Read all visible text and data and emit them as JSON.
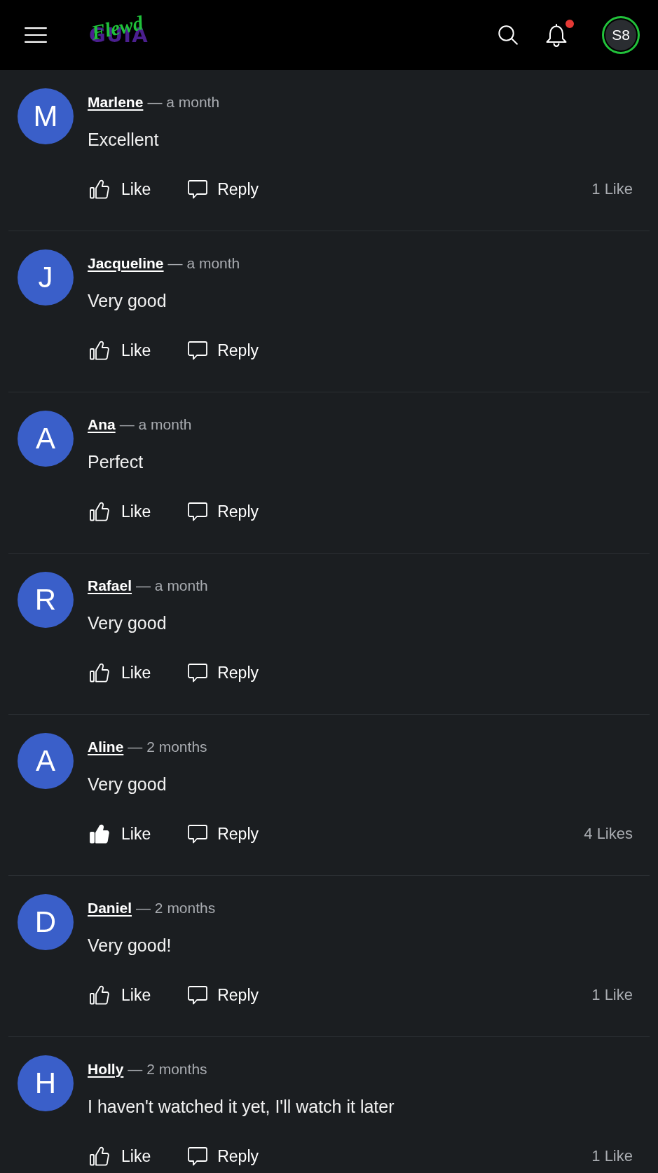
{
  "header": {
    "logo": {
      "word": "GUIA",
      "script": "Flewd"
    },
    "notifications": {
      "unread": true
    },
    "user": {
      "initials": "S8"
    }
  },
  "comments": [
    {
      "initial": "M",
      "author": "Marlene",
      "time": "— a month",
      "text": "Excellent",
      "liked": false,
      "like_label": "Like",
      "reply_label": "Reply",
      "like_count": "1 Like"
    },
    {
      "initial": "J",
      "author": "Jacqueline",
      "time": "— a month",
      "text": "Very good",
      "liked": false,
      "like_label": "Like",
      "reply_label": "Reply"
    },
    {
      "initial": "A",
      "author": "Ana",
      "time": "— a month",
      "text": "Perfect",
      "liked": false,
      "like_label": "Like",
      "reply_label": "Reply"
    },
    {
      "initial": "R",
      "author": "Rafael",
      "time": "— a month",
      "text": "Very good",
      "liked": false,
      "like_label": "Like",
      "reply_label": "Reply"
    },
    {
      "initial": "A",
      "author": "Aline",
      "time": "— 2 months",
      "text": "Very good",
      "liked": true,
      "like_label": "Like",
      "reply_label": "Reply",
      "like_count": "4 Likes"
    },
    {
      "initial": "D",
      "author": "Daniel",
      "time": "— 2 months",
      "text": "Very good!",
      "liked": false,
      "like_label": "Like",
      "reply_label": "Reply",
      "like_count": "1 Like"
    },
    {
      "initial": "H",
      "author": "Holly",
      "time": "— 2 months",
      "text": "I haven't watched it yet, I'll watch it later",
      "liked": false,
      "like_label": "Like",
      "reply_label": "Reply",
      "like_count": "1 Like"
    }
  ]
}
